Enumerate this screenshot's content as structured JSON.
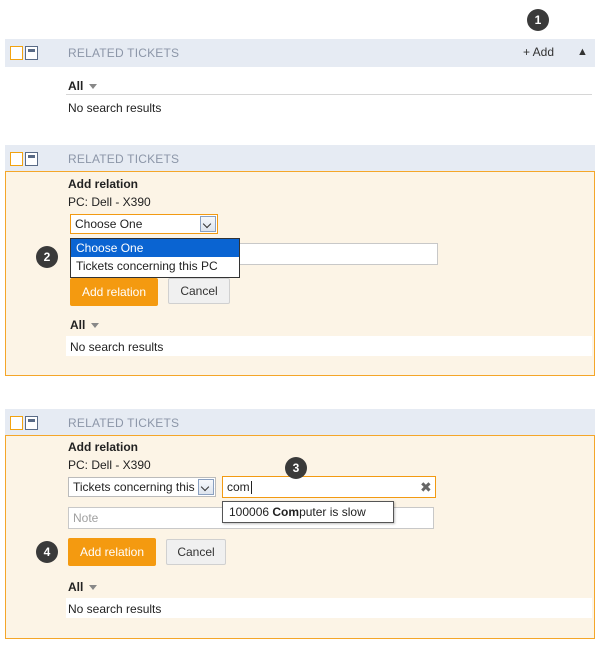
{
  "badges": [
    "1",
    "2",
    "3",
    "4"
  ],
  "colors": {
    "accent": "#f49a10",
    "header_bg": "#e6ebf3",
    "panel_border": "#f4a629",
    "selected": "#0a64d2"
  },
  "section1": {
    "title": "RELATED TICKETS",
    "add_label": "+ Add",
    "collapse_icon": "chevron-up-icon",
    "filter_label": "All",
    "no_results": "No search results"
  },
  "section2": {
    "title": "RELATED TICKETS",
    "heading": "Add relation",
    "device": "PC: Dell - X390",
    "select_value": "Choose One",
    "dropdown_options": [
      "Choose One",
      "Tickets concerning this PC"
    ],
    "add_relation": "Add relation",
    "cancel": "Cancel",
    "filter_label": "All",
    "no_results": "No search results"
  },
  "section3": {
    "title": "RELATED TICKETS",
    "heading": "Add relation",
    "device": "PC: Dell - X390",
    "select_value": "Tickets concerning this PC",
    "search_value": "com",
    "note_placeholder": "Note",
    "suggestion_id": "100006",
    "suggestion_match": "Com",
    "suggestion_rest": "puter is slow",
    "add_relation": "Add relation",
    "cancel": "Cancel",
    "filter_label": "All",
    "no_results": "No search results"
  }
}
